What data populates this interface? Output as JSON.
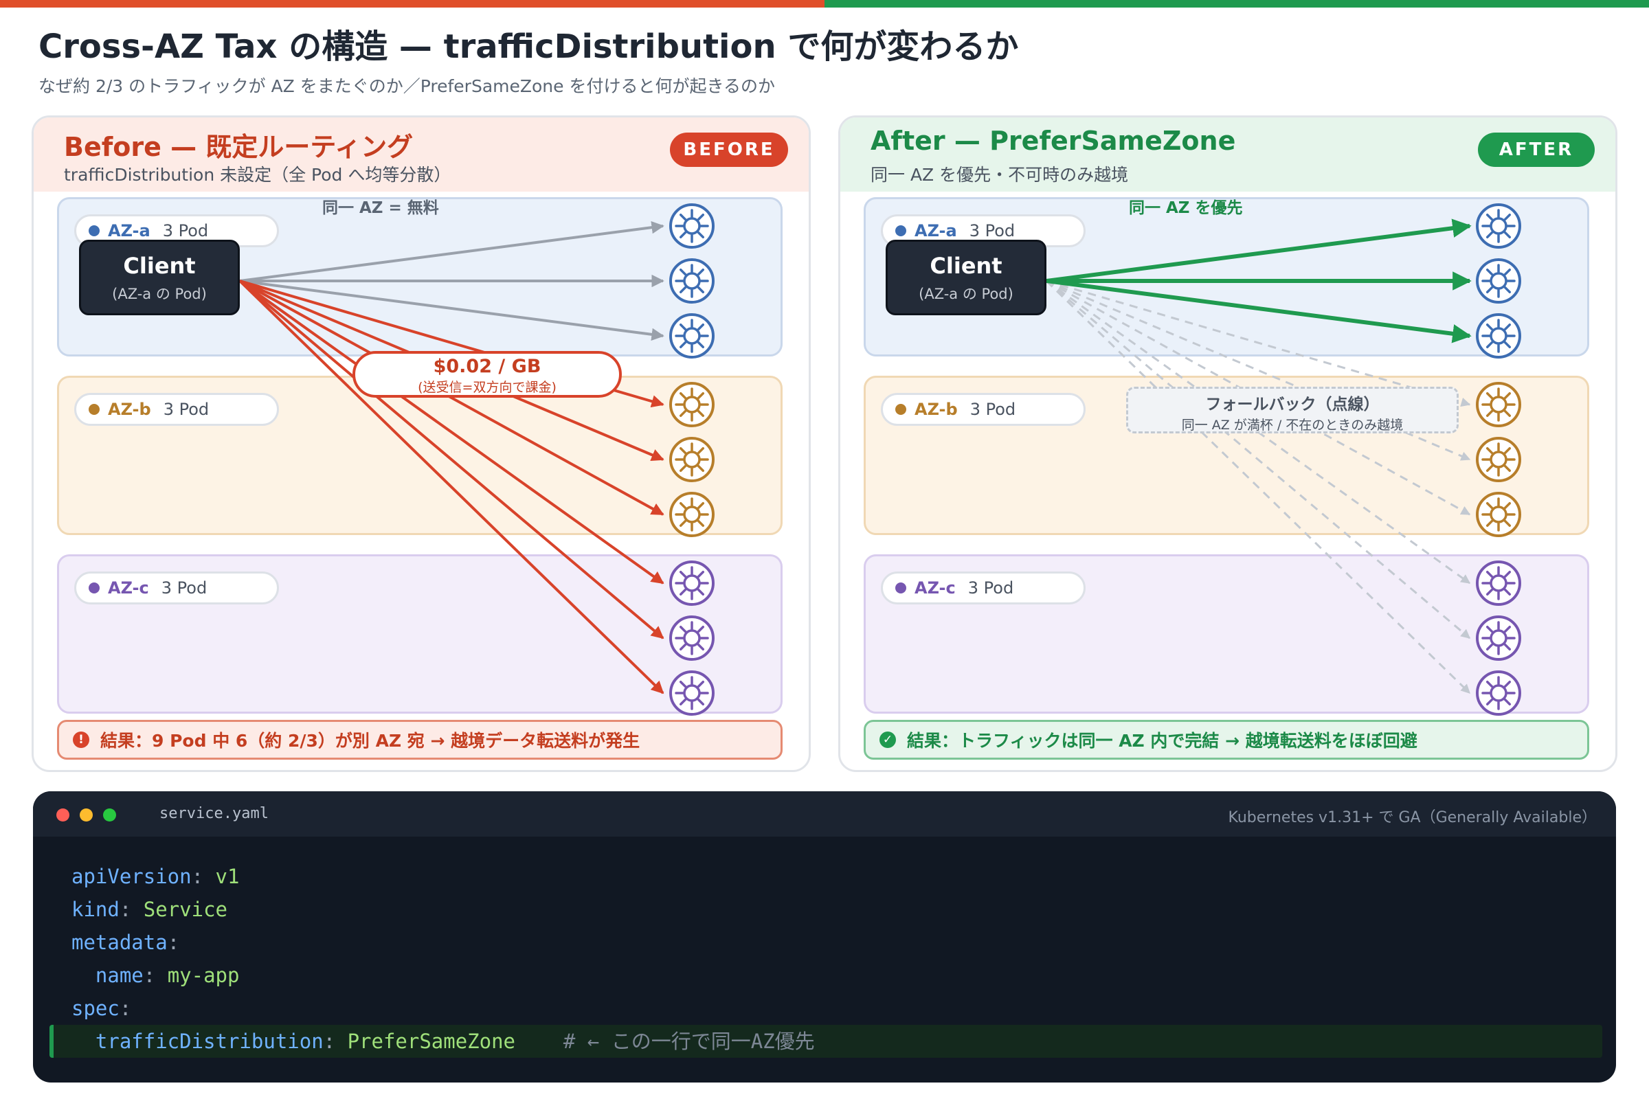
{
  "header": {
    "title": "Cross-AZ Tax の構造 — trafficDistribution で何が変わるか",
    "subtitle": "なぜ約 2/3 のトラフィックが AZ をまたぐのか／PreferSameZone を付けると何が起きるのか"
  },
  "before": {
    "title": "Before — 既定ルーティング",
    "subtitle": "trafficDistribution 未設定（全 Pod へ均等分散）",
    "badge": "BEFORE",
    "same_az_label": "同一 AZ = 無料",
    "cost_label": "$0.02 / GB",
    "cost_note": "(送受信=双方向で課金)",
    "result": "結果：9 Pod 中 6（約 2/3）が別 AZ 宛 → 越境データ転送料が発生",
    "result_icon": "alert-icon"
  },
  "after": {
    "title": "After — PreferSameZone",
    "subtitle": "同一 AZ を優先・不可時のみ越境",
    "badge": "AFTER",
    "prefer_label": "同一 AZ を優先",
    "fallback_title": "フォールバック（点線）",
    "fallback_note": "同一 AZ が満杯 / 不在のときのみ越境",
    "result": "結果：トラフィックは同一 AZ 内で完結 → 越境転送料をほぼ回避",
    "result_icon": "check-icon"
  },
  "zones": {
    "a": {
      "name": "AZ-a",
      "count": "3 Pod",
      "color": "#3d6db2"
    },
    "b": {
      "name": "AZ-b",
      "count": "3 Pod",
      "color": "#b77e2a"
    },
    "c": {
      "name": "AZ-c",
      "count": "3 Pod",
      "color": "#7656b0"
    }
  },
  "client": {
    "name": "Client",
    "sub": "(AZ-a の Pod)"
  },
  "colors": {
    "cross_az": "#d8432a",
    "same_az": "#1f9a4f",
    "free": "#9aa1ab",
    "fallback": "#c3c9d1"
  },
  "code": {
    "filename": "service.yaml",
    "ga_note": "Kubernetes v1.31+ で GA（Generally Available）",
    "lines": [
      {
        "indent": "",
        "key": "apiVersion",
        "value": "v1",
        "comment": ""
      },
      {
        "indent": "",
        "key": "kind",
        "value": "Service",
        "comment": ""
      },
      {
        "indent": "",
        "key": "metadata",
        "value": "",
        "comment": ""
      },
      {
        "indent": "  ",
        "key": "name",
        "value": "my-app",
        "comment": ""
      },
      {
        "indent": "",
        "key": "spec",
        "value": "",
        "comment": ""
      },
      {
        "indent": "  ",
        "key": "trafficDistribution",
        "value": "PreferSameZone",
        "comment": "# ← この一行で同一AZ優先"
      }
    ]
  }
}
